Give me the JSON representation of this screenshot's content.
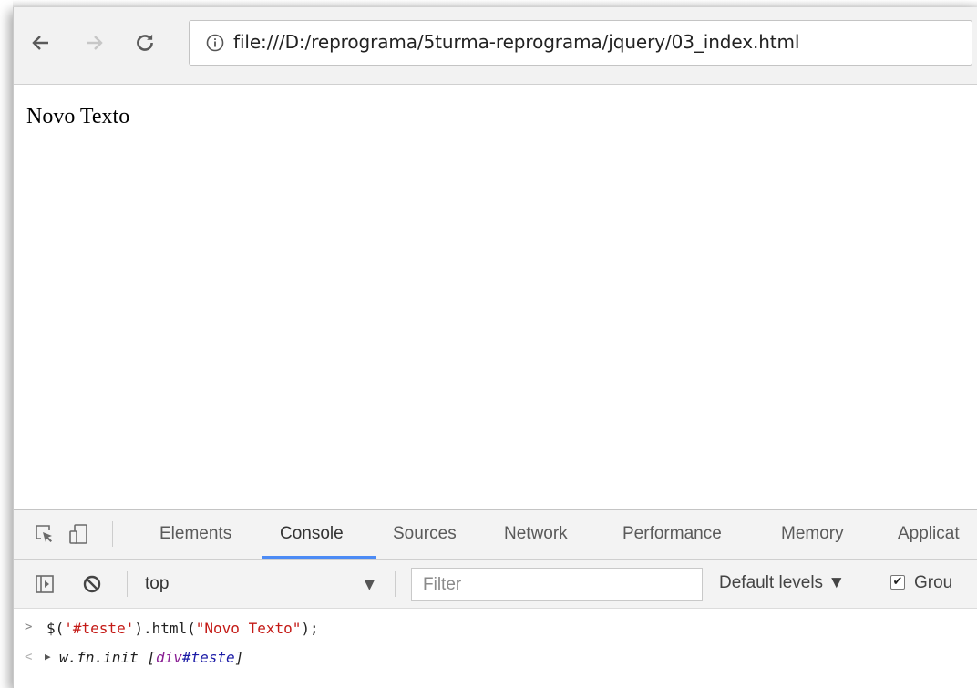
{
  "browser": {
    "url": "file:///D:/reprograma/5turma-reprograma/jquery/03_index.html",
    "back_icon": "back-arrow-icon",
    "forward_icon": "forward-arrow-icon",
    "reload_icon": "reload-icon",
    "info_icon": "info-icon"
  },
  "page": {
    "text": "Novo Texto"
  },
  "devtools": {
    "tabs": [
      "Elements",
      "Console",
      "Sources",
      "Network",
      "Performance",
      "Memory",
      "Applicat"
    ],
    "active_tab": "Console",
    "context": "top",
    "filter_placeholder": "Filter",
    "levels": "Default levels ▼",
    "group_label": "Grou",
    "group_checked": true,
    "console": {
      "input_prefix": "$(",
      "input_selector": "'#teste'",
      "input_mid": ").html(",
      "input_arg": "\"Novo Texto\"",
      "input_suffix": ");",
      "output_prefix": "w.fn.init [",
      "output_tag": "div",
      "output_id": "#teste",
      "output_suffix": "]"
    }
  },
  "colors": {
    "accent": "#4c8bf5",
    "string": "#c41a16",
    "tag": "#8a2094",
    "id": "#1a1aa6"
  }
}
